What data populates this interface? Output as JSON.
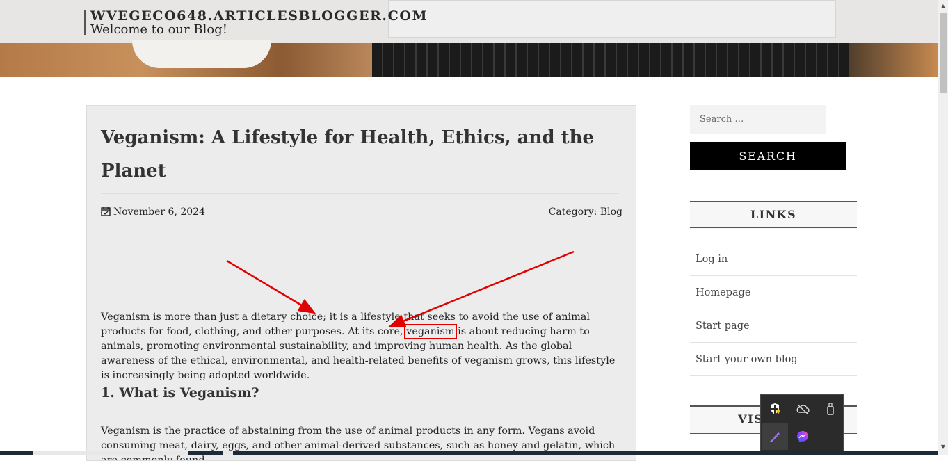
{
  "header": {
    "site_name": "WVEGECO648.ARTICLESBLOGGER.COM",
    "tagline": "Welcome to our Blog!"
  },
  "article": {
    "title": "Veganism: A Lifestyle for Health, Ethics, and the Planet",
    "date": "November 6, 2024",
    "category_label": "Category:",
    "category": "Blog",
    "intro_part1": "Veganism is more than just a dietary choice; it is a lifestyle that seeks to avoid the use of animal products for food, clothing, and other purposes. At its core, ",
    "intro_keyword": "veganism",
    "intro_part2": " is about reducing harm to animals, promoting environmental sustainability, and improving human health. As the global awareness of the ethical, environmental, and health-related benefits of veganism grows, this lifestyle is increasingly being adopted worldwide.",
    "section1_heading": "1. What is Veganism?",
    "section1_text": "Veganism is the practice of abstaining from the use of animal products in any form. Vegans avoid consuming meat, dairy, eggs, and other animal-derived substances, such as honey and gelatin, which are commonly found"
  },
  "sidebar": {
    "search_placeholder": "Search …",
    "search_button": "SEARCH",
    "links_title": "LINKS",
    "links": [
      "Log in",
      "Homepage",
      "Start page",
      "Start your own blog"
    ],
    "next_widget_title": "VISITORS"
  },
  "tray": {
    "icons": [
      "windows-security-icon",
      "onedrive-offline-icon",
      "usb-drive-icon",
      "pen-icon",
      "messenger-icon"
    ]
  },
  "colors": {
    "annotation_red": "#e00000",
    "search_button_bg": "#000000",
    "article_bg": "#ececec"
  }
}
